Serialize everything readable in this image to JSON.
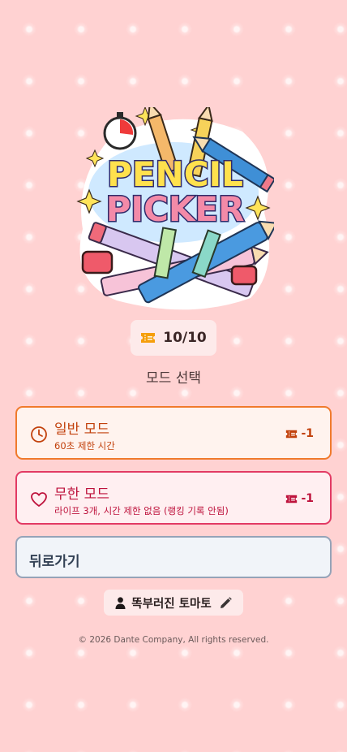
{
  "logo": {
    "line1": "PENCIL",
    "line2": "PICKER"
  },
  "tickets": {
    "count": "10/10",
    "icon": "ticket-icon",
    "color": "#f59e0b"
  },
  "section_title": "모드 선택",
  "modes": [
    {
      "title": "일반 모드",
      "description": "60초 제한 시간",
      "cost": "-1",
      "icon": "clock-icon",
      "color": "#c2410c",
      "border": "#f07a2c"
    },
    {
      "title": "무한 모드",
      "description": "라이프 3개, 시간 제한 없음 (랭킹 기록 안됨)",
      "cost": "-1",
      "icon": "heart-icon",
      "color": "#be123c",
      "border": "#e23a64"
    }
  ],
  "back_label": "뒤로가기",
  "user": {
    "name": "똑부러진 토마토",
    "icon": "person-icon",
    "edit_icon": "pencil-icon"
  },
  "copyright": "© 2026 Dante Company, All rights reserved.",
  "colors": {
    "background": "#ffd2d2",
    "chip_background": "#fdeaea"
  }
}
